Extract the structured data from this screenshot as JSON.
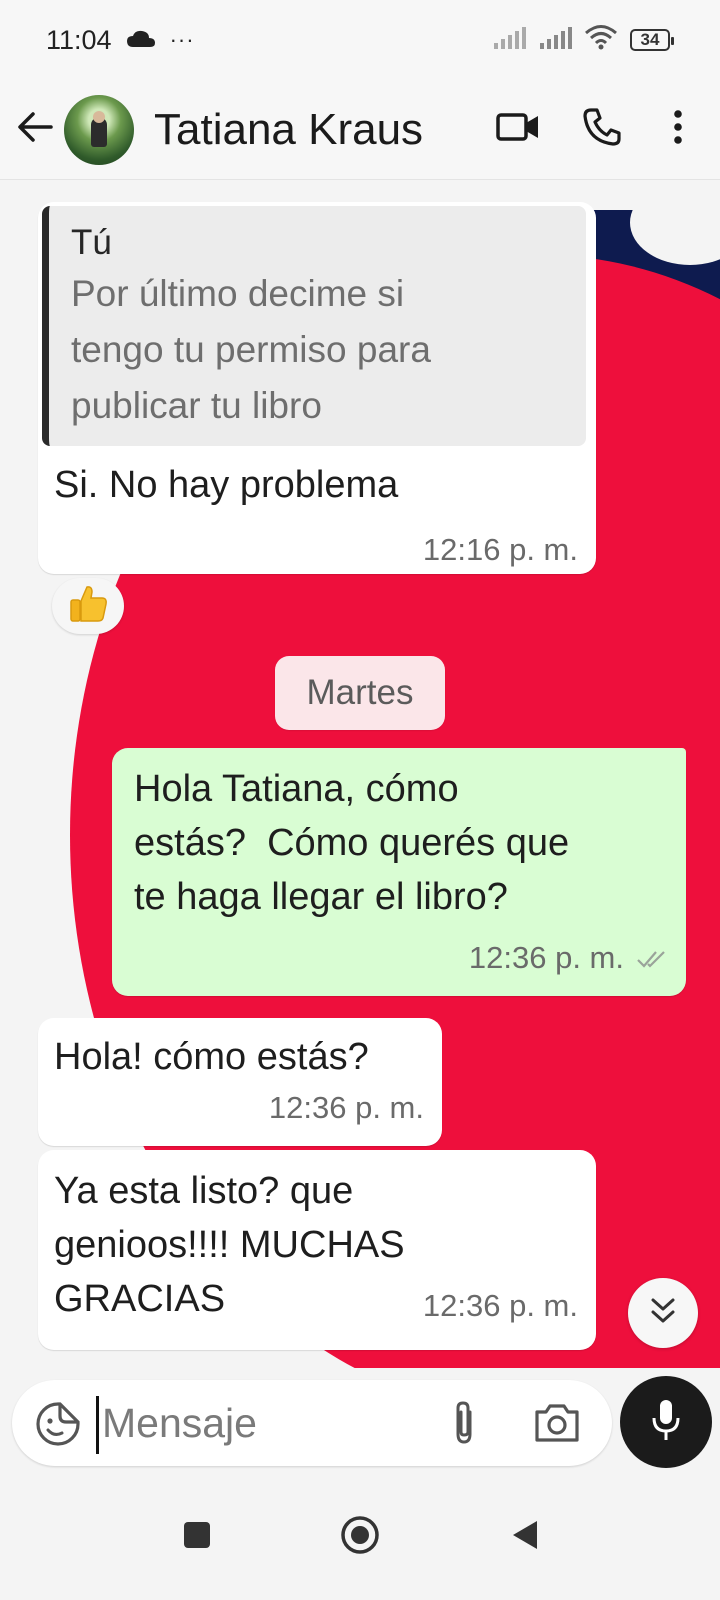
{
  "status_bar": {
    "time": "11:04",
    "ellipsis": "···",
    "battery": "34"
  },
  "header": {
    "contact_name": "Tatiana Kraus"
  },
  "messages": [
    {
      "direction": "incoming",
      "quote_author": "Tú",
      "quote_lines": [
        "Por último decime si",
        "tengo tu permiso para",
        "publicar tu libro"
      ],
      "text": "Si. No hay problema",
      "time": "12:16 p. m.",
      "reaction": "thumbs-up"
    },
    {
      "direction": "outgoing",
      "lines": [
        "Hola Tatiana, cómo",
        "estás?  Cómo querés que",
        "te haga llegar el libro?"
      ],
      "time": "12:36 p. m.",
      "status": "read"
    },
    {
      "direction": "incoming",
      "lines": [
        "Hola! cómo estás?"
      ],
      "time": "12:36 p. m."
    },
    {
      "direction": "incoming",
      "lines": [
        "Ya esta listo? que",
        "genioos!!!! MUCHAS",
        "GRACIAS"
      ],
      "time": "12:36 p. m."
    }
  ],
  "date_separator": "Martes",
  "composer": {
    "placeholder": "Mensaje"
  },
  "colors": {
    "outgoing_bubble": "#d9fdd3",
    "incoming_bubble": "#ffffff",
    "wallpaper_red": "#ee0f3c",
    "wallpaper_navy": "#0e1b4f",
    "mic_button": "#1b1b1b"
  },
  "icons": [
    "cloud-icon",
    "wifi-icon",
    "signal-icon",
    "battery-icon",
    "back-arrow-icon",
    "video-call-icon",
    "phone-icon",
    "more-options-icon",
    "thumbs-up-icon",
    "double-check-icon",
    "chevron-double-down-icon",
    "sticker-icon",
    "attach-icon",
    "camera-icon",
    "mic-icon",
    "nav-square-icon",
    "nav-circle-icon",
    "nav-back-icon"
  ]
}
